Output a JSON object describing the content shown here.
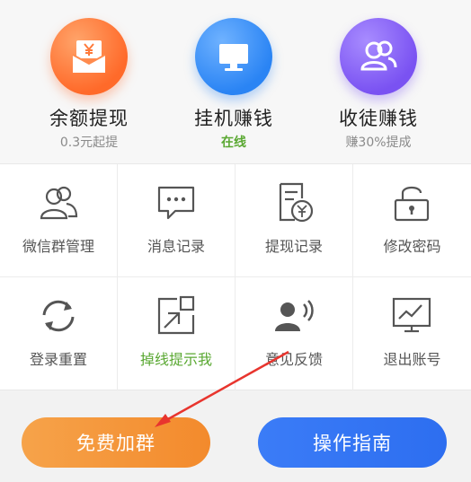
{
  "features": [
    {
      "title": "余额提现",
      "sub": "0.3元起提",
      "icon": "yen-envelope-icon",
      "color": "#ff7a3a"
    },
    {
      "title": "挂机赚钱",
      "sub": "在线",
      "icon": "monitor-icon",
      "color": "#3a8ef6"
    },
    {
      "title": "收徒赚钱",
      "sub": "赚30%提成",
      "icon": "users-icon",
      "color": "#8a62f6"
    }
  ],
  "grid": [
    {
      "label": "微信群管理",
      "icon": "group-icon"
    },
    {
      "label": "消息记录",
      "icon": "message-icon"
    },
    {
      "label": "提现记录",
      "icon": "receipt-icon"
    },
    {
      "label": "修改密码",
      "icon": "lock-icon"
    },
    {
      "label": "登录重置",
      "icon": "refresh-icon"
    },
    {
      "label": "掉线提示我",
      "icon": "expand-icon"
    },
    {
      "label": "意见反馈",
      "icon": "feedback-icon"
    },
    {
      "label": "退出账号",
      "icon": "chart-monitor-icon"
    }
  ],
  "buttons": {
    "join": "免费加群",
    "guide": "操作指南"
  },
  "colors": {
    "accent_green": "#5aa832",
    "annotation_arrow": "#e8352e"
  }
}
